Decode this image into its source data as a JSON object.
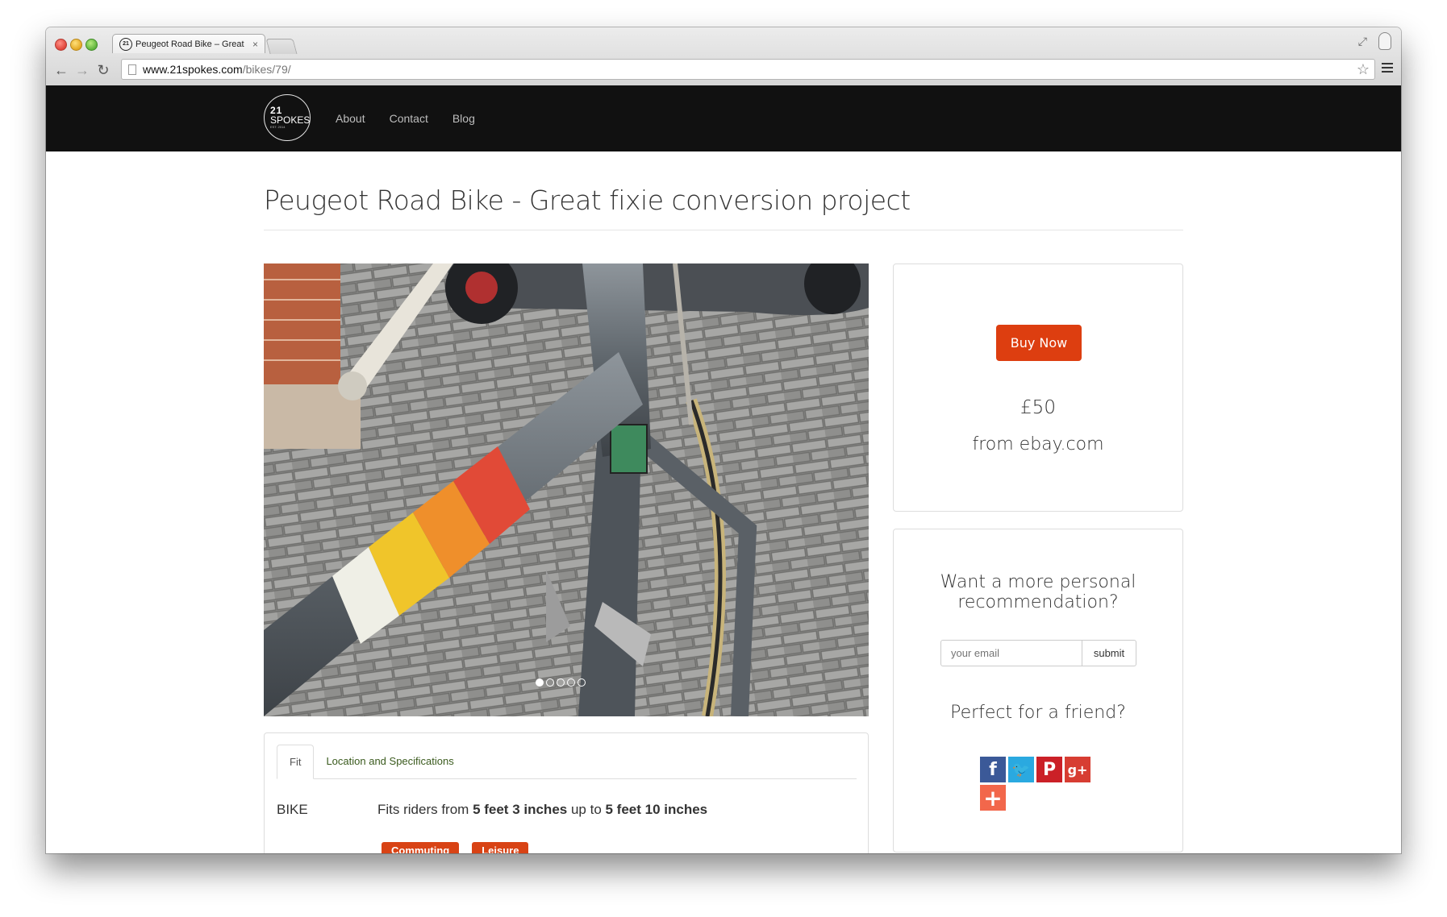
{
  "browser": {
    "tab_title": "Peugeot Road Bike – Great",
    "tab_favicon_text": "21",
    "tab_close": "×",
    "url_host": "www.21spokes.com",
    "url_path": "/bikes/79/"
  },
  "site": {
    "logo": {
      "number": "21",
      "word": "SPOKES",
      "sub": "EST. 2014"
    },
    "nav": [
      "About",
      "Contact",
      "Blog"
    ]
  },
  "listing": {
    "title": "Peugeot Road Bike - Great fixie conversion project",
    "carousel": {
      "slides": 5,
      "active_index": 0
    },
    "tabs": [
      "Fit",
      "Location and Specifications"
    ],
    "active_tab": "Fit",
    "fit": {
      "label": "BIKE",
      "text_prefix": "Fits riders from ",
      "min": "5 feet 3 inches",
      "middle": " up to ",
      "max": "5 feet 10 inches"
    },
    "tags": [
      "Commuting",
      "Leisure"
    ]
  },
  "purchase": {
    "button_label": "Buy Now",
    "price": "£50",
    "source": "from ebay.com"
  },
  "recommendation": {
    "heading_line1": "Want a more personal",
    "heading_line2": "recommendation?",
    "email_placeholder": "your email",
    "submit_label": "submit",
    "friend_heading": "Perfect for a friend?",
    "share_icons": [
      "facebook-icon",
      "twitter-icon",
      "pinterest-icon",
      "google-plus-icon",
      "more-share-icon"
    ]
  },
  "colors": {
    "nav_background": "#111111",
    "buy_button": "#dd3e10",
    "tag_background": "#d84315",
    "facebook": "#3b5998",
    "twitter": "#2aa9e0",
    "pinterest": "#cb2027",
    "google_plus": "#d73d32",
    "more_share": "#f2674b"
  }
}
